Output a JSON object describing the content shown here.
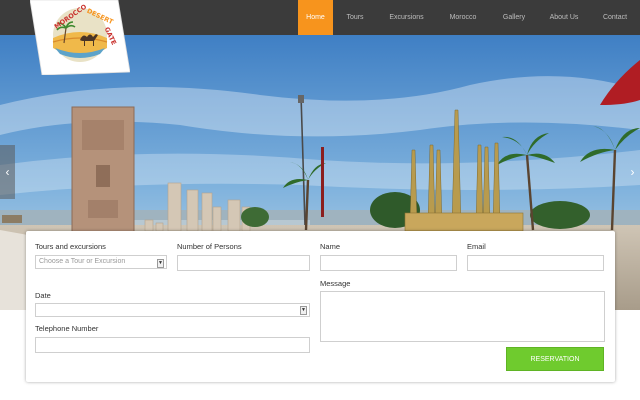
{
  "brand": {
    "logo_text": "MOROCCO DESERT GATE"
  },
  "nav": {
    "items": [
      "Home",
      "Tours",
      "Excursions",
      "Morocco",
      "Gallery",
      "About Us",
      "Contact"
    ],
    "active": "Home"
  },
  "slider": {
    "prev_glyph": "‹",
    "next_glyph": "›"
  },
  "form": {
    "tours_label": "Tours and excursions",
    "tours_value": "Choose a Tour or Excursion",
    "persons_label": "Number of Persons",
    "persons_value": "",
    "name_label": "Name",
    "name_value": "",
    "email_label": "Email",
    "email_value": "",
    "date_label": "Date",
    "date_value": "",
    "message_label": "Message",
    "message_value": "",
    "phone_label": "Telephone Number",
    "phone_value": "",
    "submit_label": "RESERVATION"
  },
  "colors": {
    "nav_bg": "#3b3b3b",
    "nav_active": "#f7941d",
    "button": "#6fcb2e"
  }
}
